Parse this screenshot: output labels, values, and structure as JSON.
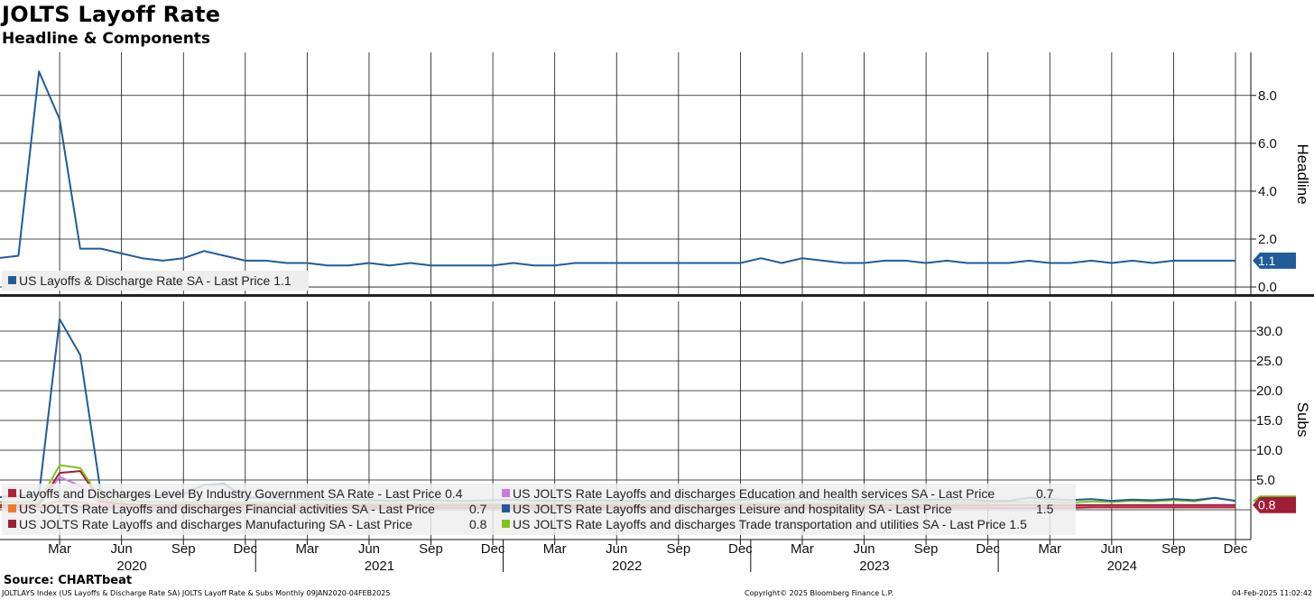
{
  "header": {
    "title": "JOLTS Layoff Rate",
    "subtitle": "Headline & Components"
  },
  "footer": {
    "source": "Source: CHARTbeat",
    "info": "JOLTLAYS Index (US Layoffs & Discharge Rate SA) JOLTS Layoff Rate & Subs  Monthly 09JAN2020-04FEB2025",
    "copyright": "Copyright© 2025 Bloomberg Finance L.P.",
    "timestamp": "04-Feb-2025 11:02:42"
  },
  "chart_data": [
    {
      "type": "line",
      "panel": "top",
      "ylabel": "Headline",
      "ylim": [
        -0.3,
        9.8
      ],
      "yticks": [
        0.0,
        2.0,
        4.0,
        6.0,
        8.0
      ],
      "ytick_labels": [
        "0.0",
        "2.0",
        "4.0",
        "6.0",
        "8.0"
      ],
      "grid": true,
      "legend_position": "bottom-left",
      "last_value_label": "1.1",
      "x": [
        "2019-12",
        "2020-01",
        "2020-02",
        "2020-03",
        "2020-04",
        "2020-05",
        "2020-06",
        "2020-07",
        "2020-08",
        "2020-09",
        "2020-10",
        "2020-11",
        "2020-12",
        "2021-01",
        "2021-02",
        "2021-03",
        "2021-04",
        "2021-05",
        "2021-06",
        "2021-07",
        "2021-08",
        "2021-09",
        "2021-10",
        "2021-11",
        "2021-12",
        "2022-01",
        "2022-02",
        "2022-03",
        "2022-04",
        "2022-05",
        "2022-06",
        "2022-07",
        "2022-08",
        "2022-09",
        "2022-10",
        "2022-11",
        "2022-12",
        "2023-01",
        "2023-02",
        "2023-03",
        "2023-04",
        "2023-05",
        "2023-06",
        "2023-07",
        "2023-08",
        "2023-09",
        "2023-10",
        "2023-11",
        "2023-12",
        "2024-01",
        "2024-02",
        "2024-03",
        "2024-04",
        "2024-05",
        "2024-06",
        "2024-07",
        "2024-08",
        "2024-09",
        "2024-10",
        "2024-11",
        "2024-12"
      ],
      "series": [
        {
          "name": "US Layoffs & Discharge Rate SA - Last Price 1.1",
          "color": "#1f5c99",
          "values": [
            1.2,
            1.3,
            9.0,
            7.0,
            1.6,
            1.6,
            1.4,
            1.2,
            1.1,
            1.2,
            1.5,
            1.3,
            1.1,
            1.1,
            1.0,
            1.0,
            0.9,
            0.9,
            1.0,
            0.9,
            1.0,
            0.9,
            0.9,
            0.9,
            0.9,
            1.0,
            0.9,
            0.9,
            1.0,
            1.0,
            1.0,
            1.0,
            1.0,
            1.0,
            1.0,
            1.0,
            1.0,
            1.2,
            1.0,
            1.2,
            1.1,
            1.0,
            1.0,
            1.1,
            1.1,
            1.0,
            1.1,
            1.0,
            1.0,
            1.0,
            1.1,
            1.0,
            1.0,
            1.1,
            1.0,
            1.1,
            1.0,
            1.1,
            1.1,
            1.1,
            1.1
          ]
        }
      ]
    },
    {
      "type": "line",
      "panel": "bottom",
      "ylabel": "Subs",
      "ylim": [
        -5,
        35
      ],
      "yticks": [
        5.0,
        10.0,
        15.0,
        20.0,
        25.0,
        30.0
      ],
      "ytick_labels": [
        "5.0",
        "10.0",
        "15.0",
        "20.0",
        "25.0",
        "30.0"
      ],
      "grid": true,
      "legend_position": "bottom-left",
      "last_value_label": "0.8",
      "x_tick_labels": [
        "Mar",
        "Jun",
        "Sep",
        "Dec",
        "Mar",
        "Jun",
        "Sep",
        "Dec",
        "Mar",
        "Jun",
        "Sep",
        "Dec",
        "Mar",
        "Jun",
        "Sep",
        "Dec",
        "Mar",
        "Jun",
        "Sep",
        "Dec"
      ],
      "x_year_labels": [
        "2020",
        "2021",
        "2022",
        "2023",
        "2024"
      ],
      "series": [
        {
          "name": "Layoffs and Discharges Level By Industry Government SA Rate - Last Price 0.4",
          "color": "#b22233",
          "values": [
            0.4,
            0.4,
            0.4,
            0.5,
            0.5,
            0.4,
            0.4,
            0.4,
            0.4,
            0.4,
            0.4,
            0.4,
            0.4,
            0.4,
            0.3,
            0.3,
            0.3,
            0.3,
            0.3,
            0.3,
            0.3,
            0.3,
            0.3,
            0.3,
            0.3,
            0.3,
            0.3,
            0.3,
            0.3,
            0.3,
            0.3,
            0.3,
            0.3,
            0.3,
            0.3,
            0.3,
            0.3,
            0.3,
            0.3,
            0.3,
            0.3,
            0.3,
            0.3,
            0.3,
            0.3,
            0.3,
            0.4,
            0.3,
            0.3,
            0.3,
            0.3,
            0.3,
            0.3,
            0.4,
            0.4,
            0.4,
            0.4,
            0.4,
            0.4,
            0.4,
            0.4
          ]
        },
        {
          "name": "US JOLTS Rate Layoffs and discharges Education and health services SA - Last Price",
          "last_price": "0.7",
          "color": "#c77be0",
          "values": [
            0.8,
            0.8,
            0.8,
            5.5,
            4.0,
            1.0,
            0.9,
            0.8,
            0.8,
            0.8,
            0.9,
            0.8,
            0.8,
            0.8,
            0.7,
            0.7,
            0.7,
            0.7,
            0.7,
            0.7,
            0.7,
            0.7,
            0.7,
            0.7,
            0.7,
            0.7,
            0.7,
            0.7,
            0.7,
            0.7,
            0.7,
            0.7,
            0.7,
            0.7,
            0.7,
            0.7,
            0.7,
            0.7,
            0.7,
            0.7,
            0.7,
            0.7,
            0.7,
            0.7,
            0.7,
            0.7,
            0.7,
            0.7,
            0.7,
            0.7,
            0.7,
            0.7,
            0.7,
            0.7,
            0.7,
            0.7,
            0.7,
            0.7,
            0.7,
            0.7,
            0.7
          ]
        },
        {
          "name": "US JOLTS Rate Layoffs and discharges Financial activities SA - Last Price",
          "last_price": "0.7",
          "color": "#f07a2a",
          "values": [
            0.6,
            0.6,
            0.6,
            1.5,
            1.2,
            0.8,
            0.7,
            0.6,
            0.6,
            0.6,
            0.6,
            0.6,
            0.6,
            0.6,
            0.6,
            0.6,
            0.6,
            0.6,
            0.6,
            0.6,
            0.6,
            0.6,
            0.6,
            0.6,
            0.6,
            0.6,
            0.6,
            0.6,
            0.6,
            0.6,
            0.6,
            0.6,
            0.6,
            0.6,
            0.6,
            0.6,
            0.6,
            0.6,
            0.6,
            0.6,
            0.6,
            0.6,
            0.6,
            0.6,
            0.6,
            0.6,
            0.6,
            0.6,
            0.6,
            0.7,
            0.7,
            0.6,
            0.6,
            0.6,
            0.6,
            0.6,
            0.6,
            0.6,
            0.6,
            0.6,
            0.7
          ]
        },
        {
          "name": "US JOLTS Rate Layoffs and discharges Leisure and hospitality SA - Last Price",
          "last_price": "1.5",
          "color": "#1f5c99",
          "values": [
            2.1,
            2.3,
            2.5,
            32.0,
            26.0,
            2.8,
            2.5,
            2.3,
            2.4,
            2.6,
            4.2,
            4.3,
            2.0,
            2.1,
            1.8,
            1.7,
            1.6,
            1.6,
            1.6,
            1.5,
            1.6,
            1.6,
            1.5,
            1.5,
            1.6,
            1.7,
            1.5,
            1.5,
            1.5,
            1.6,
            1.5,
            1.5,
            1.5,
            1.6,
            1.5,
            1.6,
            1.6,
            2.0,
            1.6,
            2.0,
            1.7,
            1.6,
            1.6,
            1.7,
            1.7,
            1.6,
            1.7,
            1.7,
            1.5,
            1.5,
            2.0,
            1.8,
            1.6,
            1.8,
            1.5,
            1.7,
            1.6,
            1.8,
            1.6,
            2.0,
            1.5
          ]
        },
        {
          "name": "US JOLTS Rate Layoffs and discharges Manufacturing SA - Last Price",
          "last_price": "0.8",
          "color": "#a01e35",
          "values": [
            0.8,
            0.8,
            0.9,
            6.2,
            6.5,
            1.4,
            1.0,
            0.8,
            0.8,
            0.8,
            0.8,
            0.8,
            0.8,
            0.8,
            0.7,
            0.7,
            0.7,
            0.7,
            0.7,
            0.7,
            0.7,
            0.7,
            0.7,
            0.7,
            0.7,
            0.7,
            0.7,
            0.7,
            0.7,
            0.7,
            0.7,
            0.7,
            0.7,
            0.7,
            0.7,
            0.8,
            0.8,
            0.8,
            0.8,
            0.8,
            0.8,
            0.8,
            0.8,
            0.8,
            0.8,
            0.8,
            0.8,
            0.8,
            0.8,
            0.8,
            0.8,
            0.8,
            0.8,
            0.8,
            0.8,
            0.8,
            0.8,
            0.8,
            0.8,
            0.8,
            0.8
          ]
        },
        {
          "name": "US JOLTS Rate Layoffs and discharges Trade transportation and utilities SA - Last Price 1.5",
          "color": "#7fc31c",
          "values": [
            1.3,
            1.3,
            1.3,
            7.5,
            7.0,
            1.8,
            1.5,
            1.3,
            1.3,
            1.2,
            1.3,
            1.3,
            1.1,
            1.1,
            1.1,
            1.0,
            1.0,
            1.0,
            1.0,
            1.0,
            1.0,
            1.0,
            1.0,
            1.0,
            1.0,
            1.0,
            1.0,
            1.0,
            1.0,
            1.1,
            1.1,
            1.1,
            1.1,
            1.1,
            1.1,
            1.1,
            1.1,
            1.1,
            1.1,
            1.1,
            1.1,
            1.1,
            1.2,
            1.2,
            1.2,
            1.2,
            1.2,
            1.2,
            1.2,
            1.3,
            1.3,
            1.3,
            1.2,
            1.4,
            1.3,
            1.5,
            1.4,
            1.6,
            1.4,
            2.0,
            1.5
          ]
        }
      ]
    }
  ]
}
